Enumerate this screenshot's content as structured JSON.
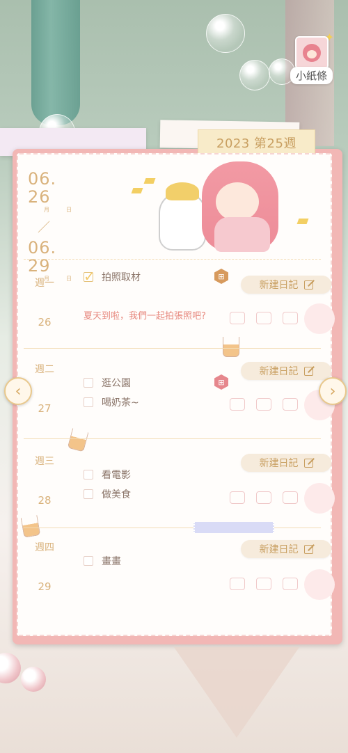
{
  "profile": {
    "name_label": "小紙條",
    "avatar_icon": "avatar-girl-icon"
  },
  "week_tab": "2023 第25週",
  "date_range": {
    "start": "06. 26",
    "end": "06. 29",
    "month_label": "月",
    "day_label": "日",
    "separator": "／"
  },
  "days": [
    {
      "weekday": "週一",
      "date": "26",
      "tasks": [
        {
          "text": "拍照取材",
          "checked": true
        }
      ],
      "memo": "夏天到啦，我們一起拍張照吧?",
      "new_diary_label": "新建日記",
      "has_gift": true,
      "gift_color": "#d79a5d"
    },
    {
      "weekday": "週二",
      "date": "27",
      "tasks": [
        {
          "text": "逛公園",
          "checked": false
        },
        {
          "text": "喝奶茶~",
          "checked": false
        }
      ],
      "memo": "",
      "new_diary_label": "新建日記",
      "has_gift": true,
      "gift_color": "#e6878d"
    },
    {
      "weekday": "週三",
      "date": "28",
      "tasks": [
        {
          "text": "看電影",
          "checked": false
        },
        {
          "text": "做美食",
          "checked": false
        }
      ],
      "memo": "",
      "new_diary_label": "新建日記",
      "has_gift": false
    },
    {
      "weekday": "週四",
      "date": "29",
      "tasks": [
        {
          "text": "畫畫",
          "checked": false
        }
      ],
      "memo": "",
      "new_diary_label": "新建日記",
      "has_gift": false
    }
  ],
  "colors": {
    "accent_gold": "#d9b27c",
    "memo_pink": "#e7897f",
    "frame_pink": "#f2b7b5"
  }
}
